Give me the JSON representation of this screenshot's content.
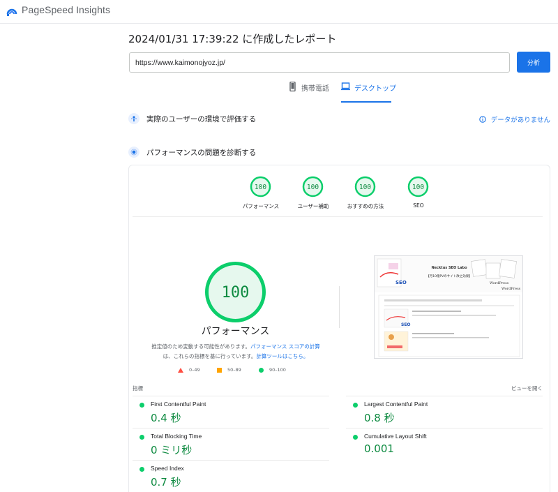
{
  "header": {
    "logo_text": "PageSpeed Insights",
    "logo_icon": "speed-gauge-icon"
  },
  "report": {
    "title": "2024/01/31 17:39:22 に作成したレポート"
  },
  "search": {
    "url_value": "https://www.kaimonojyoz.jp/",
    "analyze_label": "分析"
  },
  "tabs": [
    {
      "label": "携帯電話",
      "icon": "phone-icon",
      "active": false
    },
    {
      "label": "デスクトップ",
      "icon": "laptop-icon",
      "active": true
    }
  ],
  "crux": {
    "title": "実際のユーザーの環境で評価する",
    "no_data": "データがありません"
  },
  "diagnose": {
    "title": "パフォーマンスの問題を診断する"
  },
  "scores": [
    {
      "value": "100",
      "label": "パフォーマンス"
    },
    {
      "value": "100",
      "label": "ユーザー補助"
    },
    {
      "value": "100",
      "label": "おすすめの方法"
    },
    {
      "value": "100",
      "label": "SEO"
    }
  ],
  "performance": {
    "score": "100",
    "title": "パフォーマンス",
    "desc_1": "推定値のため変動する可能性があります。",
    "desc_link_1": "パフォーマンス スコアの計算",
    "desc_2": "は、これらの指標を基に行っています。",
    "desc_link_2": "計算ツールはこちら。"
  },
  "legend": [
    {
      "range": "0–49",
      "color": "#ff4e42"
    },
    {
      "range": "50–89",
      "color": "#ffa400"
    },
    {
      "range": "90–100",
      "color": "#0cce6b"
    }
  ],
  "metrics_section": {
    "label": "指標",
    "expand_label": "ビューを開く"
  },
  "metrics": [
    {
      "name": "First Contentful Paint",
      "value": "0.4 秒"
    },
    {
      "name": "Largest Contentful Paint",
      "value": "0.8 秒"
    },
    {
      "name": "Total Blocking Time",
      "value": "0 ミリ秒"
    },
    {
      "name": "Cumulative Layout Shift",
      "value": "0.001"
    },
    {
      "name": "Speed Index",
      "value": "0.7 秒"
    }
  ],
  "screenshot": {
    "site_title": "Necktus SEO Labo",
    "site_subtitle": "【月10億PVのサイト改之効果】",
    "seo_text": "SEO",
    "wp_text": "WordPress"
  },
  "colors": {
    "pass": "#0cce6b",
    "pass_text": "#0d8a40",
    "accent": "#1a73e8"
  }
}
